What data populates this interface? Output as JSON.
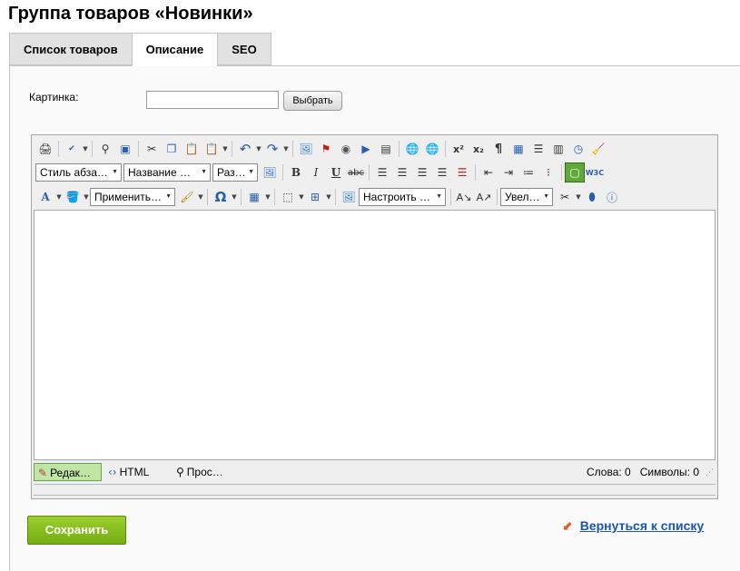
{
  "page": {
    "title": "Группа товаров «Новинки»"
  },
  "tabs": [
    {
      "label": "Список товаров"
    },
    {
      "label": "Описание",
      "active": true
    },
    {
      "label": "SEO"
    }
  ],
  "form": {
    "image_label": "Картинка:",
    "image_value": "",
    "choose_label": "Выбрать"
  },
  "editor": {
    "toolbar": {
      "paragraph_style": "Стиль абза…",
      "font_name": "Название …",
      "font_size": "Раз…",
      "apply_style": "Применить…",
      "configure": "Настроить …",
      "zoom": "Увел…"
    },
    "modes": {
      "edit": "Редак…",
      "html": "HTML",
      "preview": "Прос…"
    },
    "counts": {
      "words": "Слова: 0",
      "chars": "Символы: 0"
    }
  },
  "actions": {
    "save_label": "Сохранить",
    "back_label": "Вернуться к списку"
  },
  "colors": {
    "save_button": "#86bc1f",
    "link": "#1a55b0",
    "back_arrow": "#e3602a",
    "active_mode": "#bfe6a6"
  }
}
